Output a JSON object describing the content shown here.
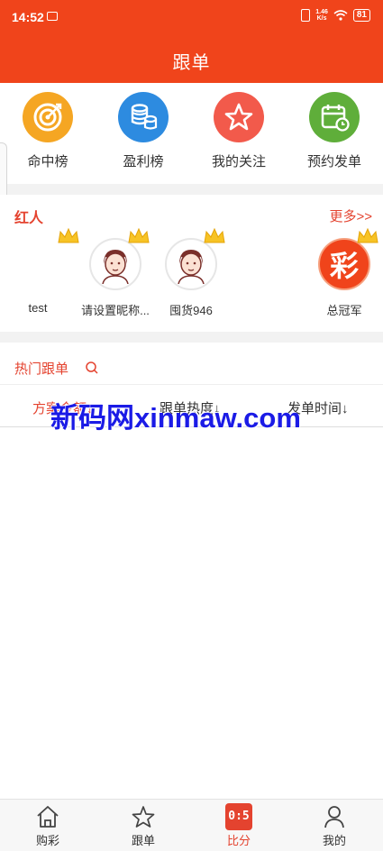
{
  "status": {
    "time": "14:52",
    "battery": "81",
    "net_top": "1.46",
    "net_bottom": "K/s"
  },
  "header": {
    "title": "跟单"
  },
  "categories": [
    {
      "label": "命中榜",
      "icon": "target-icon",
      "color": "#f5a623"
    },
    {
      "label": "盈利榜",
      "icon": "coins-icon",
      "color": "#2d8be0"
    },
    {
      "label": "我的关注",
      "icon": "star-icon",
      "color": "#f25a4b"
    },
    {
      "label": "预约发单",
      "icon": "calendar-icon",
      "color": "#5fae3a"
    }
  ],
  "red_people": {
    "title": "红人",
    "more": "更多>>",
    "items": [
      {
        "name": "test"
      },
      {
        "name": "请设置昵称..."
      },
      {
        "name": "囤货946"
      },
      {
        "name": "总冠军",
        "avatar_text": "彩"
      }
    ]
  },
  "hot": {
    "title": "热门跟单",
    "columns": [
      "方案金额↓",
      "跟单热度↓",
      "发单时间↓"
    ]
  },
  "watermark": "新码网xinmaw.com",
  "nav": [
    {
      "label": "购彩",
      "icon": "home-icon"
    },
    {
      "label": "跟单",
      "icon": "star-outline-icon"
    },
    {
      "label": "比分",
      "icon": "score-icon",
      "badge": "0:5"
    },
    {
      "label": "我的",
      "icon": "user-icon"
    }
  ]
}
